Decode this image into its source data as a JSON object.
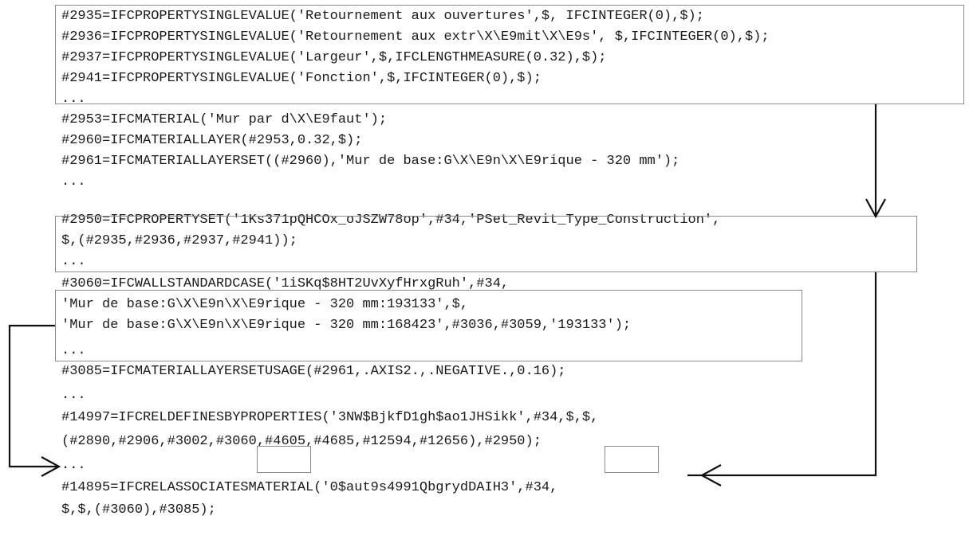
{
  "lines": [
    "#2935=IFCPROPERTYSINGLEVALUE('Retournement aux ouvertures',$, IFCINTEGER(0),$);",
    "#2936=IFCPROPERTYSINGLEVALUE('Retournement aux extr\\X\\E9mit\\X\\E9s', $,IFCINTEGER(0),$);",
    "#2937=IFCPROPERTYSINGLEVALUE('Largeur',$,IFCLENGTHMEASURE(0.32),$);",
    "#2941=IFCPROPERTYSINGLEVALUE('Fonction',$,IFCINTEGER(0),$);",
    "...",
    "#2953=IFCMATERIAL('Mur par d\\X\\E9faut');",
    "#2960=IFCMATERIALLAYER(#2953,0.32,$);",
    "#2961=IFCMATERIALLAYERSET((#2960),'Mur de base:G\\X\\E9n\\X\\E9rique - 320 mm');",
    "...",
    "#2950=IFCPROPERTYSET('1Ks371pQHCOx_oJSZW78op',#34,'PSet_Revit_Type_Construction',",
    "$,(#2935,#2936,#2937,#2941));",
    "...",
    "#3060=IFCWALLSTANDARDCASE('1iSKq$8HT2UvXyfHrxgRuh',#34,",
    "'Mur de base:G\\X\\E9n\\X\\E9rique - 320 mm:193133',$,",
    "'Mur de base:G\\X\\E9n\\X\\E9rique - 320 mm:168423',#3036,#3059,'193133');",
    "...",
    "#3085=IFCMATERIALLAYERSETUSAGE(#2961,.AXIS2.,.NEGATIVE.,0.16);",
    "...",
    "#14997=IFCRELDEFINESBYPROPERTIES('3NW$BjkfD1gh$ao1JHSikk',#34,$,$,",
    "(#2890,#2906,#3002,#3060,#4605,#4685,#12594,#12656),#2950);",
    "...",
    "#14895=IFCRELASSOCIATESMATERIAL('0$aut9s4991QbgrydDAIH3',#34,",
    "$,$,(#3060),#3085);"
  ]
}
